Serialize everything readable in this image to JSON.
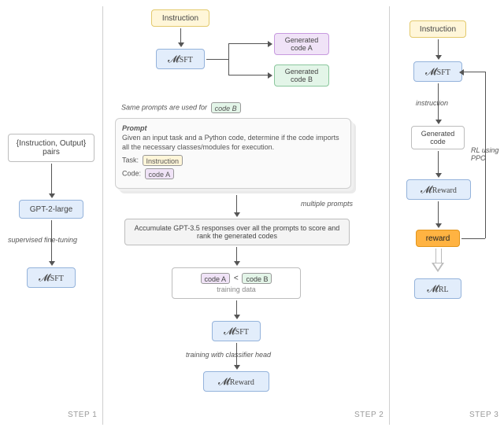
{
  "step_labels": {
    "s1": "STEP 1",
    "s2": "STEP 2",
    "s3": "STEP 3"
  },
  "models": {
    "m_sft": "𝓜SFT",
    "m_reward": "𝓜Reward",
    "m_rl": "𝓜RL"
  },
  "labels": {
    "instruction": "Instruction",
    "gen_code_a": "Generated\ncode A",
    "gen_code_b": "Generated\ncode B",
    "gen_code": "Generated\ncode",
    "reward": "reward",
    "pairs": "{Instruction, Output}\npairs",
    "gpt2": "GPT-2-large",
    "sft_edge": "supervised fine-tuning",
    "same_prompts": "Same prompts are used for",
    "code_b_chip": "code B",
    "prompt_title": "Prompt",
    "prompt_body": "Given an input task and a Python code, determine if the code imports all the necessary classes/modules for execution.",
    "task_row": "Task:",
    "instruction_chip": "Instruction",
    "code_row": "Code:",
    "code_a_chip": "code A",
    "multiple_prompts": "multiple prompts",
    "accum": "Accumulate GPT-3.5 responses over all the prompts to score and rank the generated codes",
    "less_than": "<",
    "training_data": "training data",
    "classifier_head": "training with classifier head",
    "instruction_edge": "instruction",
    "rl_edge": "RL using\nPPO"
  }
}
